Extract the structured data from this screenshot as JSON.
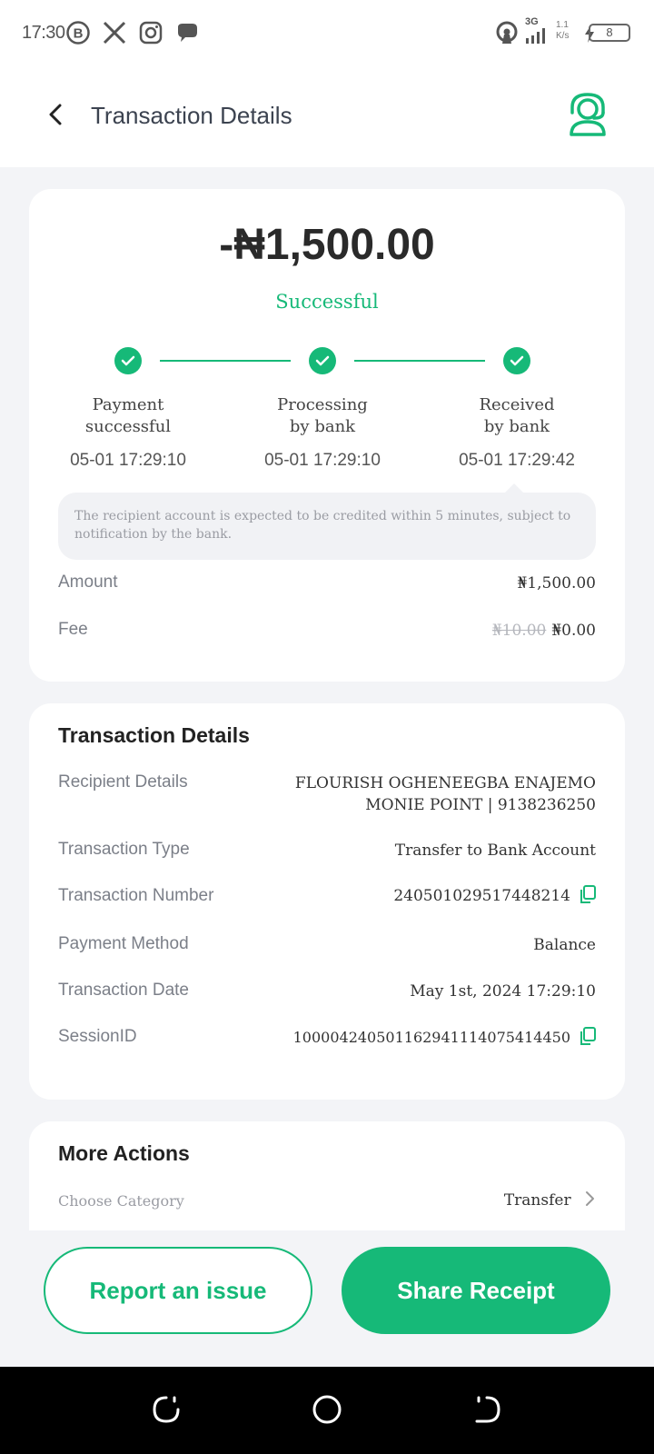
{
  "status_bar": {
    "time": "17:30",
    "network": "3G",
    "speed": "1.1 K/s",
    "battery": "8",
    "icons": [
      "b-icon",
      "x-icon",
      "instagram-icon",
      "chat-icon",
      "hotspot-icon",
      "signal-icon",
      "charging-icon",
      "battery-icon"
    ]
  },
  "header": {
    "title": "Transaction Details",
    "back_icon": "chevron-left-icon",
    "support_icon": "customer-service-icon"
  },
  "summary": {
    "amount": "-₦1,500.00",
    "status": "Successful",
    "steps": [
      {
        "label_line1": "Payment",
        "label_line2": "successful",
        "time": "05-01 17:29:10"
      },
      {
        "label_line1": "Processing",
        "label_line2": "by bank",
        "time": "05-01 17:29:10"
      },
      {
        "label_line1": "Received",
        "label_line2": "by bank",
        "time": "05-01 17:29:42"
      }
    ],
    "note": "The recipient account is expected to be credited within 5 minutes, subject to notification by the bank.",
    "amount_label": "Amount",
    "amount_value": "₦1,500.00",
    "fee_label": "Fee",
    "fee_original": "₦10.00",
    "fee_value": "₦0.00"
  },
  "details": {
    "title": "Transaction Details",
    "recipient_label": "Recipient Details",
    "recipient_name": "FLOURISH OGHENEEGBA ENAJEMO",
    "recipient_bank": "MONIE POINT | 9138236250",
    "type_label": "Transaction Type",
    "type_value": "Transfer to Bank Account",
    "number_label": "Transaction Number",
    "number_value": "240501029517448214",
    "method_label": "Payment Method",
    "method_value": "Balance",
    "date_label": "Transaction Date",
    "date_value": "May 1st, 2024 17:29:10",
    "session_label": "SessionID",
    "session_value": "100004240501162941114075414450"
  },
  "more_actions": {
    "title": "More Actions",
    "category_label": "Choose Category",
    "category_value": "Transfer"
  },
  "buttons": {
    "report": "Report an issue",
    "share": "Share Receipt"
  },
  "colors": {
    "accent": "#16b978",
    "background": "#f3f4f7"
  }
}
